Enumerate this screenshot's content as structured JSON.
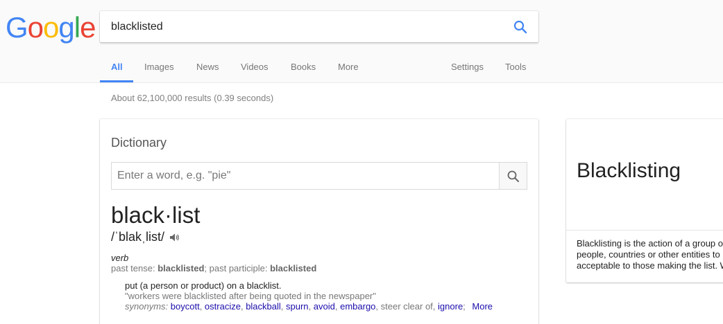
{
  "logo": {
    "text": "Google",
    "colors": [
      "#4285f4",
      "#ea4335",
      "#fbbc05",
      "#4285f4",
      "#34a853",
      "#ea4335"
    ]
  },
  "search": {
    "query": "blacklisted",
    "icon": "search-icon",
    "accent": "#4285f4"
  },
  "tabs": {
    "all": "All",
    "images": "Images",
    "news": "News",
    "videos": "Videos",
    "books": "Books",
    "more": "More",
    "settings": "Settings",
    "tools": "Tools"
  },
  "result_stats": "About 62,100,000 results (0.39 seconds)",
  "dictionary": {
    "title": "Dictionary",
    "input_placeholder": "Enter a word, e.g. \"pie\"",
    "headword": "black·list",
    "pronunciation": "/ˈblakˌlist/",
    "speaker_icon": "speaker-icon",
    "part_of_speech": "verb",
    "forms": {
      "past_tense_label": "past tense: ",
      "past_tense": "blacklisted",
      "separator": "; past participle: ",
      "past_participle": "blacklisted"
    },
    "definition": "put (a person or product) on a blacklist.",
    "example": "\"workers were blacklisted after being quoted in the newspaper\"",
    "synonyms_label": "synonyms:",
    "synonyms": {
      "s1": "boycott",
      "s2": "ostracize",
      "s3": "blackball",
      "s4": "spurn",
      "s5": "avoid",
      "s6": "embargo",
      "s7": "steer clear of",
      "s8": "ignore"
    },
    "more": "More",
    "link_color": "#1a0dab"
  },
  "knowledge_panel": {
    "title": "Blacklisting",
    "description_lines": {
      "l1": "Blacklisting is the action of a group or",
      "l2": "people, countries or other entities to",
      "l3": "acceptable to those making the list. W"
    }
  }
}
